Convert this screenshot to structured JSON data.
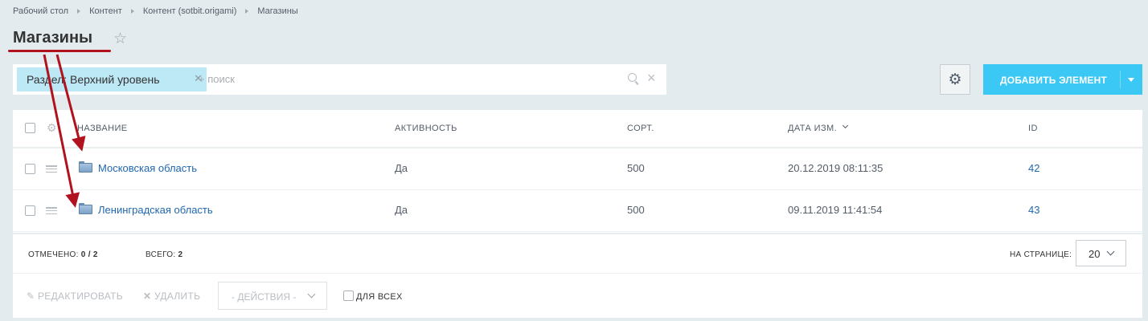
{
  "breadcrumb": [
    "Рабочий стол",
    "Контент",
    "Контент (sotbit.origami)",
    "Магазины"
  ],
  "page_title": "Магазины",
  "filter": {
    "chip_label": "Раздел: Верхний уровень",
    "search_placeholder": "+ поиск"
  },
  "toolbar": {
    "add_label": "ДОБАВИТЬ ЭЛЕМЕНТ"
  },
  "columns": [
    "НАЗВАНИЕ",
    "АКТИВНОСТЬ",
    "СОРТ.",
    "ДАТА ИЗМ.",
    "ID"
  ],
  "rows": [
    {
      "name": "Московская область",
      "active": "Да",
      "sort": "500",
      "date": "20.12.2019 08:11:35",
      "id": "42"
    },
    {
      "name": "Ленинградская область",
      "active": "Да",
      "sort": "500",
      "date": "09.11.2019 11:41:54",
      "id": "43"
    }
  ],
  "footer": {
    "selected_label": "ОТМЕЧЕНО:",
    "selected_value": "0 / 2",
    "total_label": "ВСЕГО:",
    "total_value": "2",
    "per_page_label": "НА СТРАНИЦЕ:",
    "per_page_value": "20"
  },
  "actions": {
    "edit": "РЕДАКТИРОВАТЬ",
    "delete": "УДАЛИТЬ",
    "select": "- ДЕЙСТВИЯ -",
    "for_all": "ДЛЯ ВСЕХ"
  },
  "colors": {
    "accent": "#3bc8f5",
    "chip": "#bde8f6",
    "link": "#2067b0",
    "annotation": "#b0121e"
  }
}
